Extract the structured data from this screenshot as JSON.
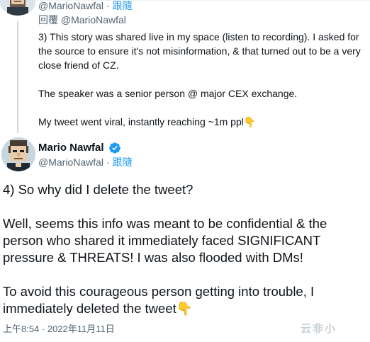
{
  "reply_tweet": {
    "handle": "@MarioNawfal",
    "follow_label": "跟隨",
    "replying_to": "回覆 @MarioNawfal",
    "paragraphs": [
      "3) This story was shared live in my space (listen to recording). I asked for the source to ensure it's not misinformation, & that turned out to be a very close friend of CZ.",
      "The speaker was a senior person @ major CEX exchange.",
      "My tweet went viral, instantly reaching ~1m ppl"
    ],
    "emoji": "👇"
  },
  "main_tweet": {
    "author_name": "Mario Nawfal",
    "handle": "@MarioNawfal",
    "follow_label": "跟隨",
    "paragraphs": [
      "4) So why did I delete the tweet?",
      "Well, seems this info was meant to be confidential & the person who shared it immediately faced SIGNIFICANT pressure & THREATS! I was also flooded with DMs!",
      "To avoid this courageous person getting into trouble, I immediately deleted the tweet"
    ],
    "emoji": "👇",
    "timestamp": "上午8:54 · 2022年11月11日"
  },
  "watermark": {
    "text": "云非小"
  },
  "colors": {
    "text": "#0f1419",
    "secondary": "#536471",
    "accent": "#1d9bf0",
    "thread_line": "#cfd9de"
  }
}
